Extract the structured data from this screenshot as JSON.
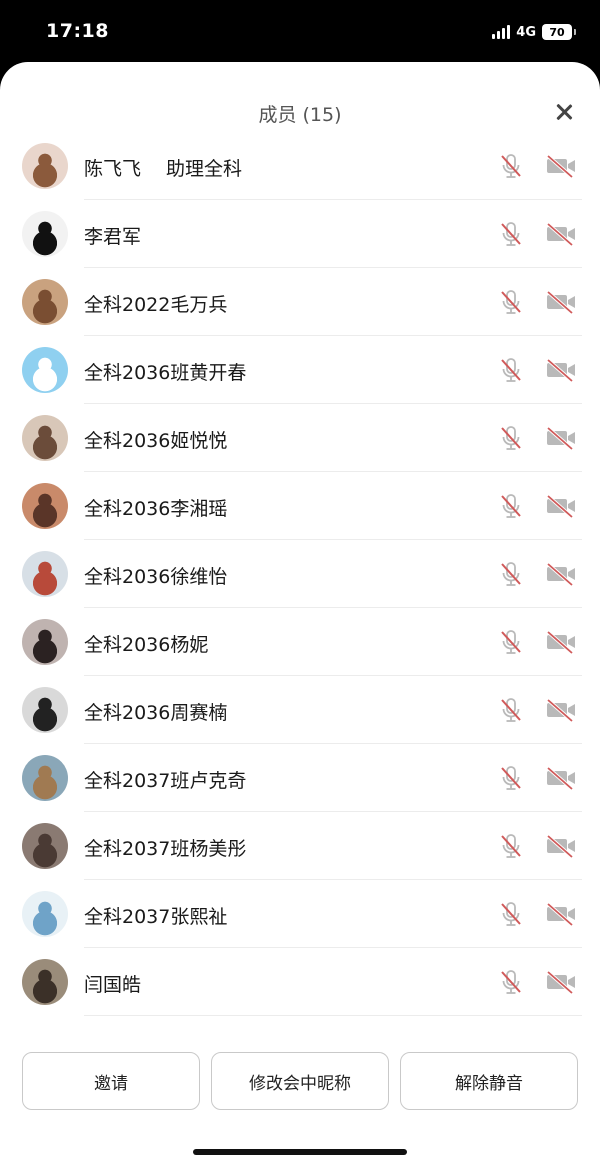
{
  "status_bar": {
    "time": "17:18",
    "network": "4G",
    "battery": "70"
  },
  "sheet": {
    "title": "成员 (15)"
  },
  "members": [
    {
      "name": "陈飞飞　 助理全科",
      "avatar_color": "#e9d6cc",
      "avatar_accent": "#8b5a3c"
    },
    {
      "name": "李君军",
      "avatar_color": "#f2f2f2",
      "avatar_accent": "#111111"
    },
    {
      "name": "全科2022毛万兵",
      "avatar_color": "#c9a27f",
      "avatar_accent": "#7a4e32"
    },
    {
      "name": "全科2036班黄开春",
      "avatar_color": "#8fd0f0",
      "avatar_accent": "#ffffff"
    },
    {
      "name": "全科2036姬悦悦",
      "avatar_color": "#d8c7b8",
      "avatar_accent": "#6b4c3a"
    },
    {
      "name": "全科2036李湘瑶",
      "avatar_color": "#c98a6a",
      "avatar_accent": "#5a3528"
    },
    {
      "name": "全科2036徐维怡",
      "avatar_color": "#d7dfe6",
      "avatar_accent": "#b84a3a"
    },
    {
      "name": "全科2036杨妮",
      "avatar_color": "#bfb3b0",
      "avatar_accent": "#2b2222"
    },
    {
      "name": "全科2036周赛楠",
      "avatar_color": "#d9d9d9",
      "avatar_accent": "#222222"
    },
    {
      "name": "全科2037班卢克奇",
      "avatar_color": "#8aa7b8",
      "avatar_accent": "#a07a52"
    },
    {
      "name": "全科2037班杨美彤",
      "avatar_color": "#8a7a72",
      "avatar_accent": "#4a3a34"
    },
    {
      "name": "全科2037张熙祉",
      "avatar_color": "#e8f1f6",
      "avatar_accent": "#6fa3c8"
    },
    {
      "name": "闫国皓",
      "avatar_color": "#9a8c7a",
      "avatar_accent": "#3b3028"
    }
  ],
  "actions": {
    "invite": "邀请",
    "rename": "修改会中昵称",
    "unmute": "解除静音"
  },
  "colors": {
    "muted_icon": "#d05a5a",
    "icon_gray": "#b9b9b9"
  }
}
